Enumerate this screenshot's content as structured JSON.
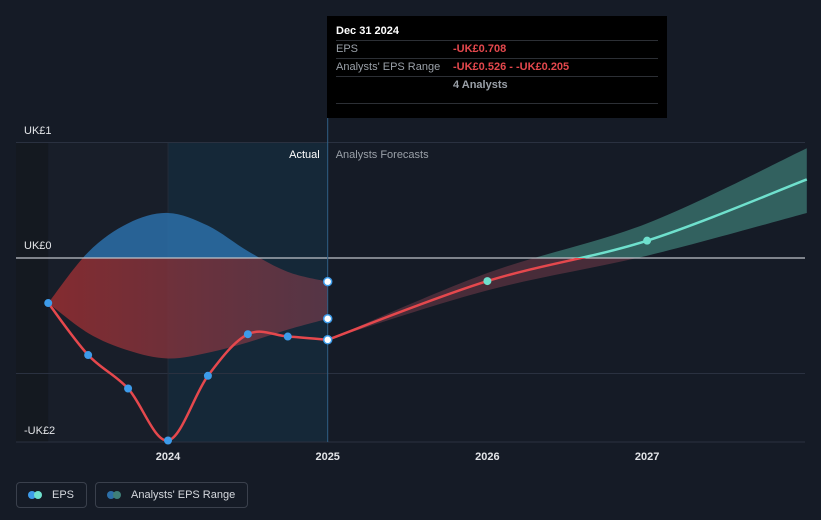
{
  "chart_data": {
    "type": "line",
    "y_ticks": [
      "UK£1",
      "UK£0",
      "-UK£2"
    ],
    "x_ticks": [
      "2024",
      "2025",
      "2026",
      "2027"
    ],
    "region_labels": {
      "actual": "Actual",
      "forecast": "Analysts Forecasts"
    },
    "series": [
      {
        "name": "EPS",
        "kind": "actual",
        "points": [
          {
            "x": 2023.25,
            "y": -0.39
          },
          {
            "x": 2023.5,
            "y": -0.84
          },
          {
            "x": 2023.75,
            "y": -1.13
          },
          {
            "x": 2024.0,
            "y": -1.58
          },
          {
            "x": 2024.25,
            "y": -1.02
          },
          {
            "x": 2024.5,
            "y": -0.66
          },
          {
            "x": 2024.75,
            "y": -0.68
          },
          {
            "x": 2025.0,
            "y": -0.708
          }
        ]
      },
      {
        "name": "EPS",
        "kind": "forecast",
        "points": [
          {
            "x": 2025.0,
            "y": -0.708
          },
          {
            "x": 2026.0,
            "y": -0.2
          },
          {
            "x": 2027.0,
            "y": 0.15
          },
          {
            "x": 2028.0,
            "y": 0.68
          }
        ]
      }
    ],
    "range_band": {
      "name": "Analysts' EPS Range",
      "actual_x": [
        2023.25,
        2023.5,
        2023.75,
        2024.0,
        2024.25,
        2024.5,
        2024.75,
        2025.0
      ],
      "actual_high": [
        -0.39,
        0.05,
        0.3,
        0.39,
        0.28,
        0.06,
        -0.12,
        -0.205
      ],
      "actual_low": [
        -0.39,
        -0.65,
        -0.8,
        -0.87,
        -0.82,
        -0.73,
        -0.62,
        -0.526
      ],
      "forecast_x": [
        2025.0,
        2026.0,
        2027.0,
        2028.0
      ],
      "forecast_high": [
        -0.708,
        -0.13,
        0.3,
        0.95
      ],
      "forecast_low": [
        -0.708,
        -0.28,
        0.02,
        0.39
      ]
    },
    "highlight_x": 2025.0,
    "forecast_start_x": 2025.0
  },
  "tooltip": {
    "date": "Dec 31 2024",
    "eps_label": "EPS",
    "eps_value": "-UK£0.708",
    "range_label": "Analysts' EPS Range",
    "range_value": "-UK£0.526 - -UK£0.205",
    "analysts": "4 Analysts"
  },
  "legend": {
    "eps_label": "EPS",
    "range_label": "Analysts' EPS Range"
  },
  "colors": {
    "background": "#151b26",
    "eps_actual": "#e5484d",
    "eps_forecast": "#6fe0cd",
    "marker_actual": "#3d9be9",
    "range_positive": "#2c6fa8",
    "range_negative": "#7a2e35",
    "forecast_band": "#3f7f78",
    "gridline": "#2a3140",
    "zero_line": "#bfc3c9"
  }
}
